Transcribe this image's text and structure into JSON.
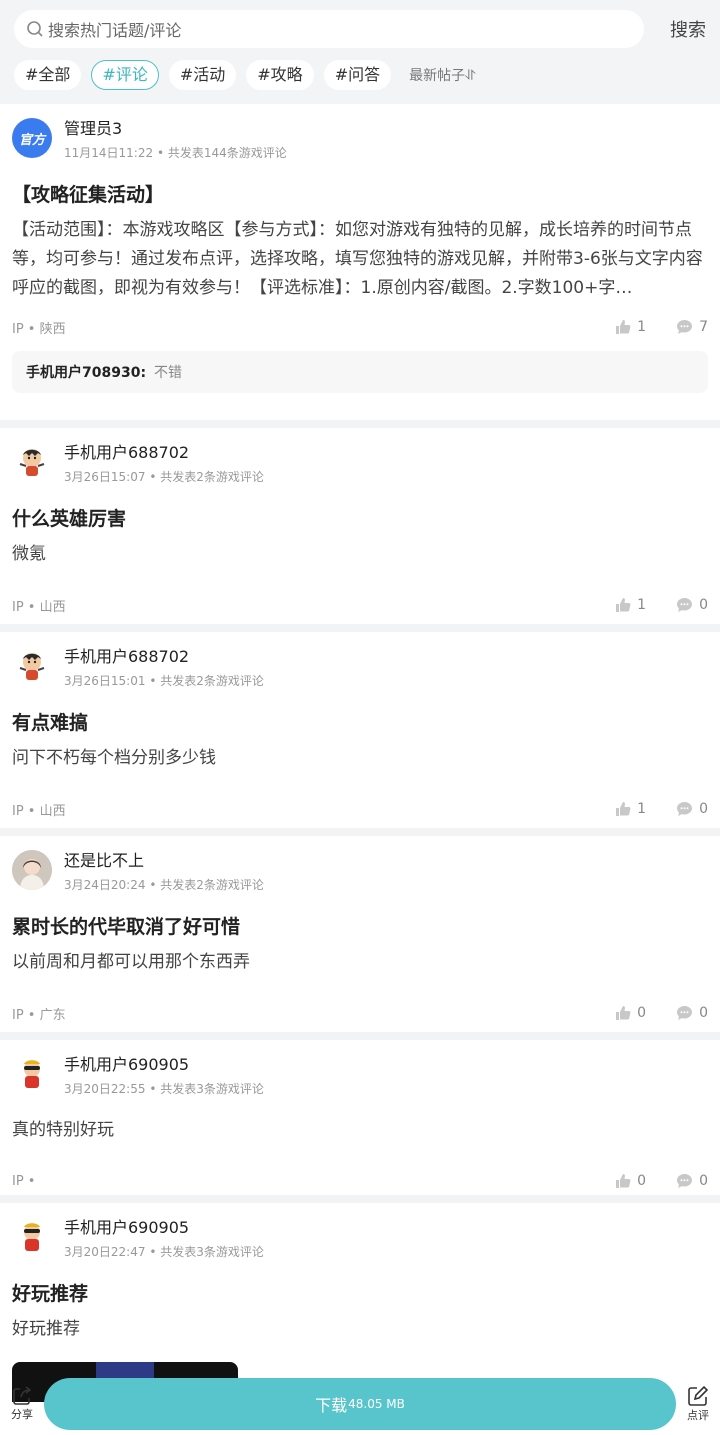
{
  "search": {
    "placeholder": "搜索热门话题/评论",
    "button": "搜索"
  },
  "tags": [
    {
      "label": "#全部",
      "active": false
    },
    {
      "label": "#评论",
      "active": true
    },
    {
      "label": "#活动",
      "active": false
    },
    {
      "label": "#攻略",
      "active": false
    },
    {
      "label": "#问答",
      "active": false
    }
  ],
  "sort_label": "最新帖子⥯",
  "posts": [
    {
      "user": "管理员3",
      "avatar_text": "官方",
      "time": "11月14日11:22",
      "count": "共发表144条游戏评论",
      "title": "【攻略征集活动】",
      "body": "【活动范围】：本游戏攻略区【参与方式】：如您对游戏有独特的见解，成长培养的时间节点等，均可参与！通过发布点评，选择攻略，填写您独特的游戏见解，并附带3-6张与文字内容呼应的截图，即视为有效参与！【评选标准】：1.原创内容/截图。2.字数100+字…",
      "ip": "IP • 陕西",
      "likes": "1",
      "comments": "7",
      "reply_user": "手机用户708930:",
      "reply_text": "不错"
    },
    {
      "user": "手机用户688702",
      "time": "3月26日15:07",
      "count": "共发表2条游戏评论",
      "title": "什么英雄厉害",
      "body": "微氪",
      "ip": "IP • 山西",
      "likes": "1",
      "comments": "0"
    },
    {
      "user": "手机用户688702",
      "time": "3月26日15:01",
      "count": "共发表2条游戏评论",
      "title": "有点难搞",
      "body": "问下不朽每个档分别多少钱",
      "ip": "IP • 山西",
      "likes": "1",
      "comments": "0"
    },
    {
      "user": "还是比不上",
      "time": "3月24日20:24",
      "count": "共发表2条游戏评论",
      "title": "累时长的代毕取消了好可惜",
      "body": "以前周和月都可以用那个东西弄",
      "ip": "IP • 广东",
      "likes": "0",
      "comments": "0"
    },
    {
      "user": "手机用户690905",
      "time": "3月20日22:55",
      "count": "共发表3条游戏评论",
      "body": "真的特别好玩",
      "ip": "IP •",
      "likes": "0",
      "comments": "0"
    },
    {
      "user": "手机用户690905",
      "time": "3月20日22:47",
      "count": "共发表3条游戏评论",
      "title": "好玩推荐",
      "body": "好玩推荐"
    }
  ],
  "bottom": {
    "share": "分享",
    "download": "下载",
    "size": "48.05 MB",
    "review": "点评"
  },
  "colors": {
    "accent": "#58c4cb",
    "official_avatar": "#3a7bf0"
  }
}
